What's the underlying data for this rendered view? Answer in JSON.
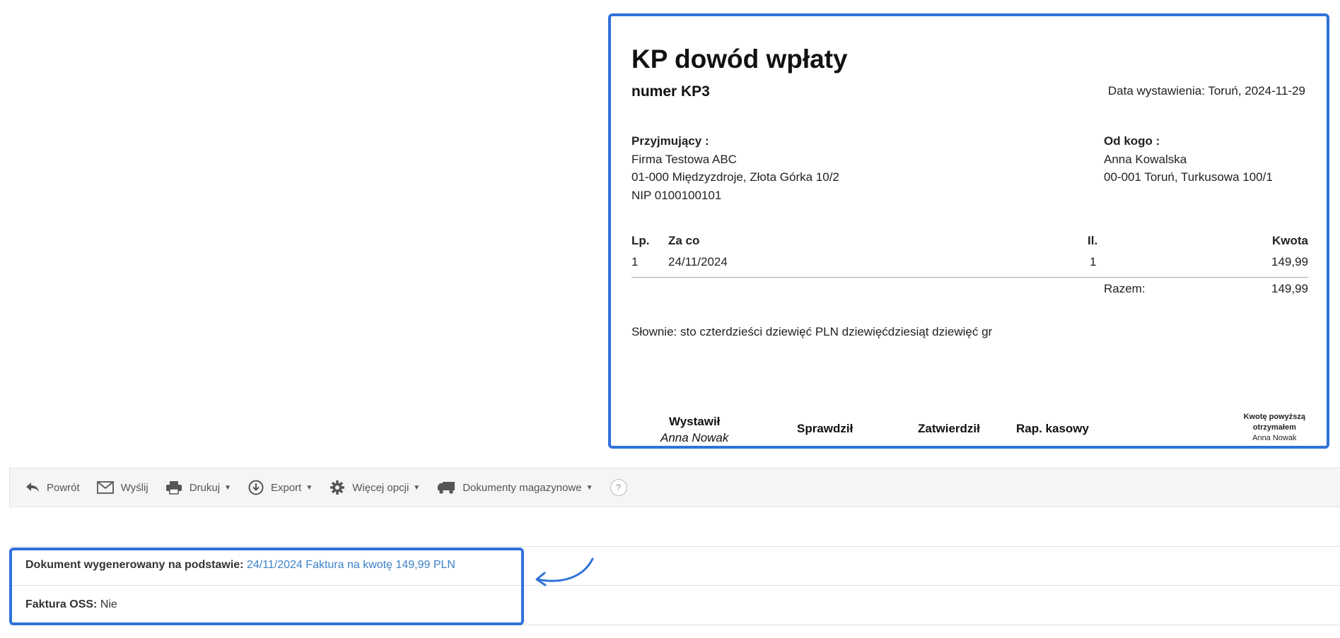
{
  "document": {
    "title": "KP dowód wpłaty",
    "number": "numer KP3",
    "issue_date": "Data wystawienia: Toruń, 2024-11-29",
    "receiver": {
      "heading": "Przyjmujący :",
      "name": "Firma Testowa ABC",
      "address": "01-000 Międzyzdroje, Złota Górka 10/2",
      "nip": "NIP 0100100101"
    },
    "payer": {
      "heading": "Od kogo :",
      "name": "Anna Kowalska",
      "address": "00-001 Toruń, Turkusowa 100/1"
    },
    "items": {
      "headers": {
        "lp": "Lp.",
        "za_co": "Za co",
        "il": "Il.",
        "kwota": "Kwota"
      },
      "rows": [
        {
          "lp": "1",
          "za_co": "24/11/2024",
          "il": "1",
          "kwota": "149,99"
        }
      ],
      "total_label": "Razem:",
      "total_value": "149,99"
    },
    "in_words": "Słownie: sto czterdzieści dziewięć PLN dziewięćdziesiąt dziewięć gr",
    "signatures": {
      "issued_label": "Wystawił",
      "issued_name": "Anna Nowak",
      "checked_label": "Sprawdził",
      "approved_label": "Zatwierdził",
      "cash_report_label": "Rap. kasowy",
      "received_line1": "Kwotę powyższą",
      "received_line2": "otrzymałem",
      "received_name": "Anna Nowak"
    }
  },
  "toolbar": {
    "back": "Powrót",
    "send": "Wyślij",
    "print": "Drukuj",
    "export": "Export",
    "more": "Więcej opcji",
    "warehouse": "Dokumenty magazynowe",
    "help": "?"
  },
  "info": {
    "generated_label": "Dokument wygenerowany na podstawie:",
    "generated_link": "24/11/2024 Faktura na kwotę 149,99 PLN",
    "oss_label": "Faktura OSS:",
    "oss_value": "Nie"
  },
  "colors": {
    "accent": "#2f72da",
    "link": "#3d82c8"
  }
}
